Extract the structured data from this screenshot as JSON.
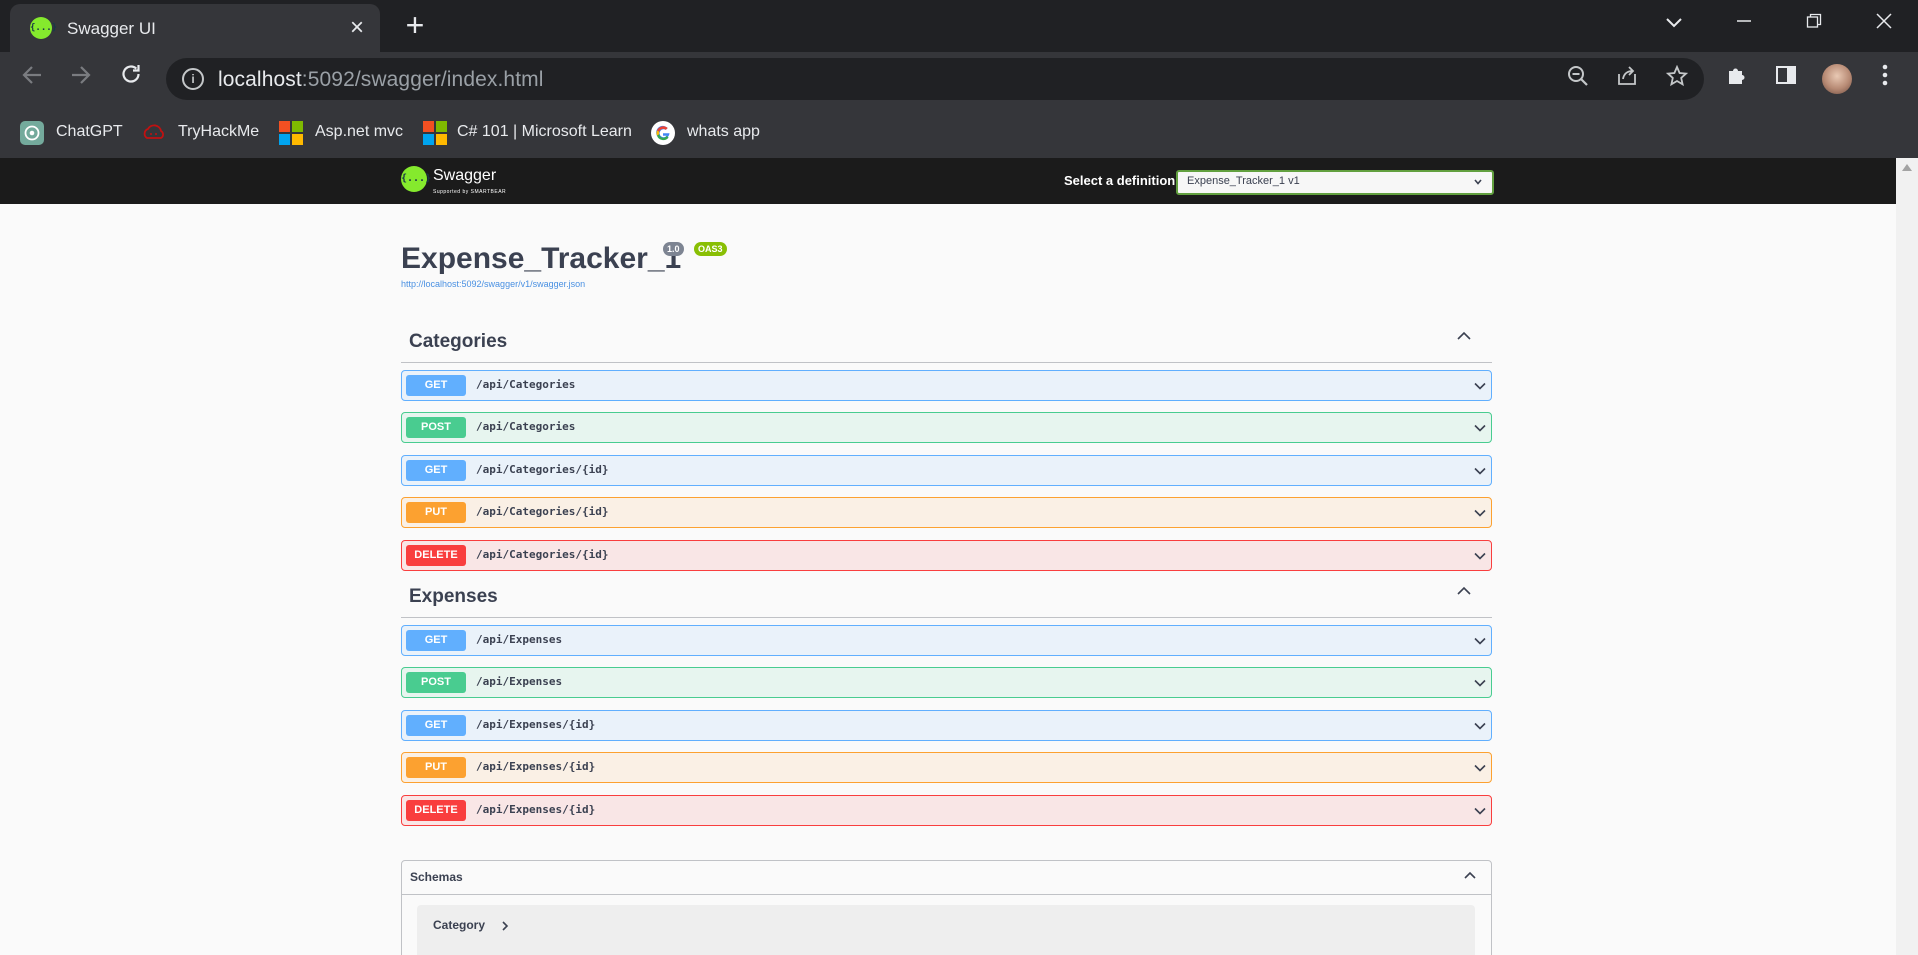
{
  "browser": {
    "tab_title": "Swagger UI",
    "favicon_glyph": "{...}",
    "url_host": "localhost",
    "url_rest": ":5092/swagger/index.html",
    "bookmarks": [
      {
        "label": "ChatGPT",
        "icon": "chatgpt-icon"
      },
      {
        "label": "TryHackMe",
        "icon": "tryhackme-icon"
      },
      {
        "label": "Asp.net mvc",
        "icon": "microsoft-icon"
      },
      {
        "label": "C# 101 | Microsoft Learn",
        "icon": "microsoft-icon"
      },
      {
        "label": "whats app",
        "icon": "google-icon"
      }
    ]
  },
  "swagger": {
    "logo_glyph": "{...}",
    "brand": "Swagger",
    "brand_sub": "Supported by SMARTBEAR",
    "definition_label": "Select a definition",
    "definition_value": "Expense_Tracker_1 v1",
    "title": "Expense_Tracker_1",
    "version": "1.0",
    "oas": "OAS3",
    "spec_url": "http://localhost:5092/swagger/v1/swagger.json",
    "tags": [
      {
        "name": "Categories",
        "operations": [
          {
            "method": "GET",
            "path": "/api/Categories"
          },
          {
            "method": "POST",
            "path": "/api/Categories"
          },
          {
            "method": "GET",
            "path": "/api/Categories/{id}"
          },
          {
            "method": "PUT",
            "path": "/api/Categories/{id}"
          },
          {
            "method": "DELETE",
            "path": "/api/Categories/{id}"
          }
        ]
      },
      {
        "name": "Expenses",
        "operations": [
          {
            "method": "GET",
            "path": "/api/Expenses"
          },
          {
            "method": "POST",
            "path": "/api/Expenses"
          },
          {
            "method": "GET",
            "path": "/api/Expenses/{id}"
          },
          {
            "method": "PUT",
            "path": "/api/Expenses/{id}"
          },
          {
            "method": "DELETE",
            "path": "/api/Expenses/{id}"
          }
        ]
      }
    ],
    "schemas_title": "Schemas",
    "schemas": [
      "Category"
    ]
  },
  "colors": {
    "get": "#61affe",
    "post": "#49cc90",
    "put": "#fca130",
    "delete": "#f93e3e",
    "swagger_green": "#85ea2d",
    "topbar": "#1b1b1b"
  }
}
